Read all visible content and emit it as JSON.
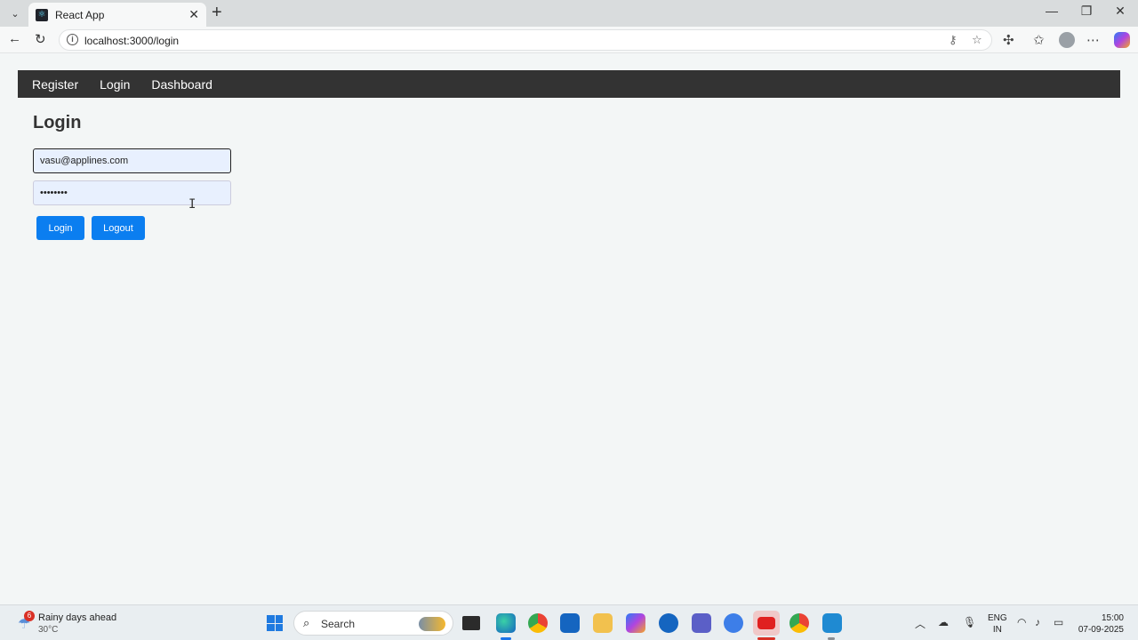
{
  "browser": {
    "tab_title": "React App",
    "url": "localhost:3000/login"
  },
  "app_nav": {
    "items": [
      "Register",
      "Login",
      "Dashboard"
    ]
  },
  "login": {
    "heading": "Login",
    "email_value": "vasu@applines.com",
    "password_value": "••••••••",
    "login_button": "Login",
    "logout_button": "Logout"
  },
  "taskbar": {
    "weather_text": "Rainy days ahead",
    "weather_temp": "30°C",
    "weather_badge": "6",
    "search_label": "Search",
    "lang_line1": "ENG",
    "lang_line2": "IN",
    "time": "15:00",
    "date": "07-09-2025"
  }
}
